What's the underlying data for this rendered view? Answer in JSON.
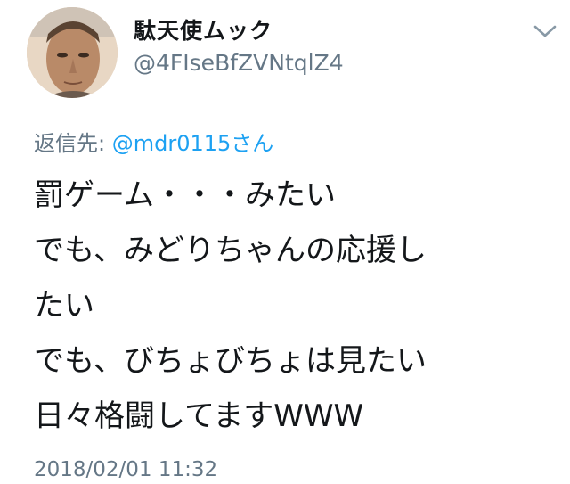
{
  "author": {
    "display_name": "駄天使ムック",
    "handle": "@4FIseBfZVNtqlZ4"
  },
  "reply": {
    "prefix": "返信先: ",
    "mention": "@mdr0115さん"
  },
  "tweet": {
    "lines": [
      "罰ゲーム・・・みたい",
      "でも、みどりちゃんの応援し",
      "たい",
      "でも、びちょびちょは見たい",
      "日々格闘してますWWW"
    ]
  },
  "timestamp": "2018/02/01 11:32",
  "icons": {
    "avatar": "profile-photo",
    "menu": "chevron-down-icon"
  },
  "colors": {
    "text": "#14171a",
    "secondary": "#657786",
    "accent": "#1da1f2"
  }
}
